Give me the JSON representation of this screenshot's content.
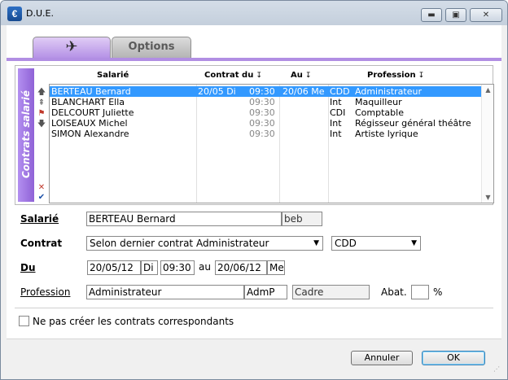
{
  "window": {
    "title": "D.U.E.",
    "app_icon_glyph": "€"
  },
  "tabs": [
    {
      "label": "",
      "icon": "plane-icon"
    },
    {
      "label": "Options"
    }
  ],
  "side_label": "Contrats salarié",
  "table": {
    "headers": {
      "salarie": "Salarié",
      "contrat_du": "Contrat du",
      "au": "Au",
      "profession": "Profession"
    },
    "rows": [
      {
        "name": "BERTEAU Bernard",
        "date": "20/05 Di",
        "time": "09:30",
        "au": "20/06 Me",
        "ctype": "CDD",
        "profession": "Administrateur",
        "selected": true
      },
      {
        "name": "BLANCHART Ella",
        "date": "",
        "time": "09:30",
        "au": "",
        "ctype": "Int",
        "profession": "Maquilleur"
      },
      {
        "name": "DELCOURT Juliette",
        "date": "",
        "time": "09:30",
        "au": "",
        "ctype": "CDI",
        "profession": "Comptable"
      },
      {
        "name": "LOISEAUX Michel",
        "date": "",
        "time": "09:30",
        "au": "",
        "ctype": "Int",
        "profession": "Régisseur général théâtre"
      },
      {
        "name": "SIMON Alexandre",
        "date": "",
        "time": "09:30",
        "au": "",
        "ctype": "Int",
        "profession": "Artiste lyrique"
      }
    ]
  },
  "form": {
    "salarie": {
      "label": "Salarié",
      "value": "BERTEAU Bernard",
      "code": "beb"
    },
    "contrat": {
      "label": "Contrat",
      "value": "Selon dernier contrat Administrateur",
      "type": "CDD"
    },
    "du": {
      "label": "Du",
      "date": "20/05/12",
      "day": "Di",
      "time": "09:30",
      "au_label": "au",
      "au_date": "20/06/12",
      "au_day": "Me"
    },
    "profession": {
      "label": "Profession",
      "value": "Administrateur",
      "code": "AdmP",
      "category": "Cadre",
      "abat_label": "Abat.",
      "abat_value": "",
      "percent": "%"
    }
  },
  "checkbox_label": "Ne pas créer les contrats correspondants",
  "buttons": {
    "cancel": "Annuler",
    "ok": "OK"
  },
  "colors": {
    "accent": "#b18ee3",
    "selection": "#3399ff"
  }
}
